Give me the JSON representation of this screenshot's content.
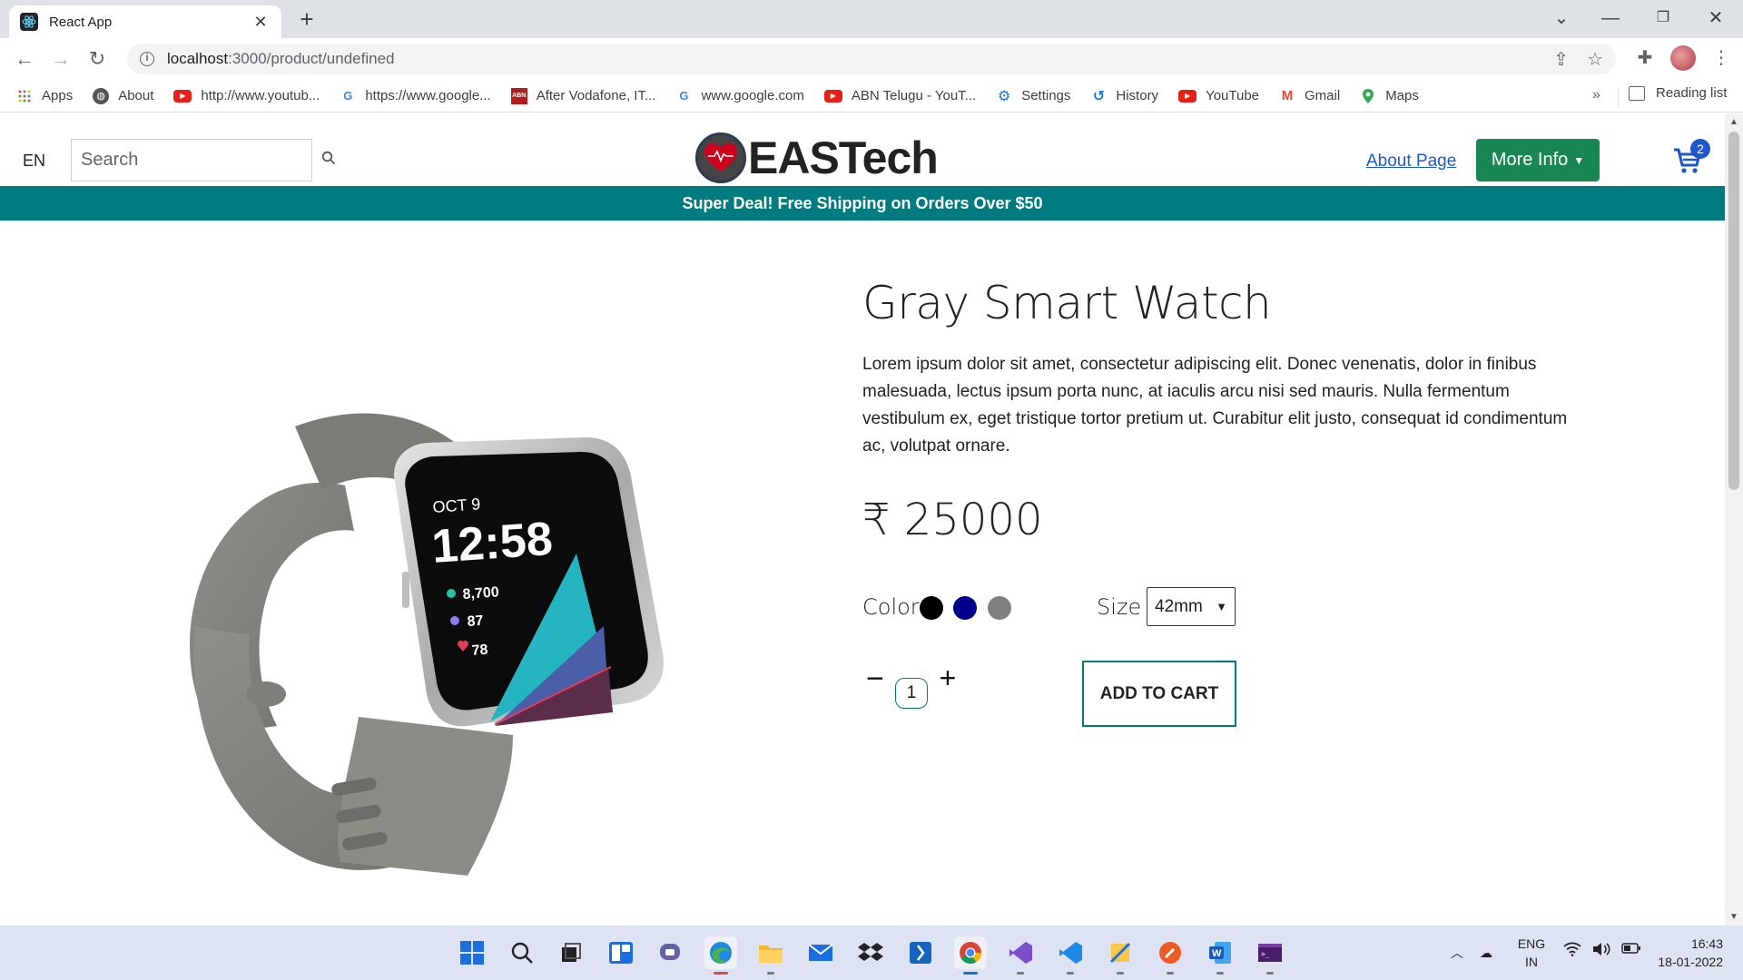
{
  "browser": {
    "tab_title": "React App",
    "url_host": "localhost",
    "url_path": ":3000/product/undefined",
    "bookmarks": [
      {
        "label": "Apps",
        "icon": "apps-grid-icon"
      },
      {
        "label": "About",
        "icon": "globe-icon"
      },
      {
        "label": "http://www.youtub...",
        "icon": "youtube-icon"
      },
      {
        "label": "https://www.google...",
        "icon": "google-icon"
      },
      {
        "label": "After Vodafone, IT...",
        "icon": "news-icon"
      },
      {
        "label": "www.google.com",
        "icon": "google-icon"
      },
      {
        "label": "ABN Telugu - YouT...",
        "icon": "youtube-icon"
      },
      {
        "label": "Settings",
        "icon": "gear-icon"
      },
      {
        "label": "History",
        "icon": "history-icon"
      },
      {
        "label": "YouTube",
        "icon": "youtube-icon"
      },
      {
        "label": "Gmail",
        "icon": "gmail-icon"
      },
      {
        "label": "Maps",
        "icon": "maps-icon"
      }
    ],
    "more_bookmarks": "»",
    "reading_list": "Reading list"
  },
  "header": {
    "lang": "EN",
    "search_placeholder": "Search",
    "brand": "EASTech",
    "about_link": "About Page",
    "more_info": "More Info",
    "cart_count": "2"
  },
  "promo": "Super Deal! Free Shipping on Orders Over $50",
  "product": {
    "title": "Gray Smart Watch",
    "description": "Lorem ipsum dolor sit amet, consectetur adipiscing elit. Donec venenatis, dolor in finibus malesuada, lectus ipsum porta nunc, at iaculis arcu nisi sed mauris. Nulla fermentum vestibulum ex, eget tristique tortor pretium ut. Curabitur elit justo, consequat id condimentum ac, volutpat ornare.",
    "price": "₹ 25000",
    "color_label": "Color",
    "colors": [
      "#000000",
      "#00008b",
      "#808080"
    ],
    "size_label": "Size",
    "size_value": "42mm",
    "quantity": "1",
    "add_to_cart": "ADD TO CART",
    "watch_face": {
      "date": "OCT 9",
      "time": "12:58",
      "steps": "8,700",
      "stat2": "87",
      "heart": "78"
    }
  },
  "taskbar": {
    "lang_top": "ENG",
    "lang_bottom": "IN",
    "time": "16:43",
    "date": "18-01-2022"
  },
  "colors": {
    "accent": "#007b7f",
    "more_info_bg": "#198754",
    "badge": "#1e57c9"
  }
}
